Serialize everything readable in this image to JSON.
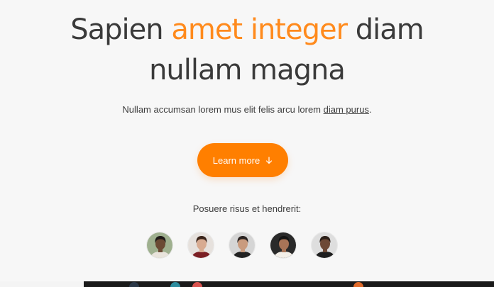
{
  "hero": {
    "title_part1": "Sapien ",
    "title_accent": "amet integer",
    "title_part2": " diam",
    "title_line2": "nullam magna",
    "subtitle_text": "Nullam accumsan lorem mus elit felis arcu lorem ",
    "subtitle_link": "diam purus",
    "subtitle_end": "."
  },
  "cta": {
    "label": "Learn more",
    "icon": "arrow-down-icon",
    "color": "#ff7f00"
  },
  "social_proof": {
    "caption": "Posuere risus et hendrerit:",
    "avatars": [
      {
        "name": "avatar-1",
        "bg": "#9fb08f",
        "skin": "#6b4a34",
        "hair": "#1e1a17",
        "shirt": "#e9e4dc"
      },
      {
        "name": "avatar-2",
        "bg": "#e6e1dd",
        "skin": "#d8ab91",
        "hair": "#3a241a",
        "shirt": "#7b1f24"
      },
      {
        "name": "avatar-3",
        "bg": "#d5d5d5",
        "skin": "#c99b7e",
        "hair": "#2a2321",
        "shirt": "#222222"
      },
      {
        "name": "avatar-4",
        "bg": "#2a2a2a",
        "skin": "#a87457",
        "hair": "#141414",
        "shirt": "#f3efe8"
      },
      {
        "name": "avatar-5",
        "bg": "#dedede",
        "skin": "#6d4936",
        "hair": "#2c2019",
        "shirt": "#1e1e1e"
      }
    ]
  },
  "colors": {
    "accent": "#ff8a1c",
    "text": "#3a3a3a",
    "background": "#f7f7f7"
  }
}
